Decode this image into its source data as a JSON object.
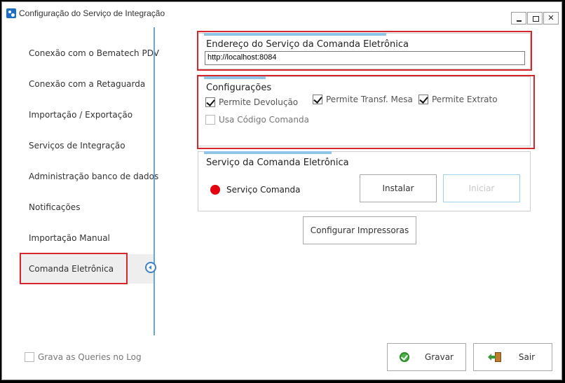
{
  "window": {
    "title": "Configuração do Serviço de Integração",
    "minimize_label": "",
    "maximize_label": "",
    "close_label": "✕"
  },
  "sidebar": {
    "items": [
      {
        "label": "Conexão com o Bematech PDV"
      },
      {
        "label": "Conexão com a Retaguarda"
      },
      {
        "label": "Importação / Exportação"
      },
      {
        "label": "Serviços de Integração"
      },
      {
        "label": "Administração banco de dados"
      },
      {
        "label": "Notificações"
      },
      {
        "label": "Importação Manual"
      },
      {
        "label": "Comanda Eletrônica",
        "active": true
      }
    ]
  },
  "address_group": {
    "title": "Endereço do Serviço da Comanda Eletrônica",
    "url_value": "http://localhost:8084"
  },
  "config_group": {
    "title": "Configurações",
    "options": [
      {
        "label": "Permite Devolução",
        "checked": true
      },
      {
        "label": "Permite Transf. Mesa",
        "checked": true
      },
      {
        "label": "Permite Extrato",
        "checked": true
      },
      {
        "label": "Usa Código Comanda",
        "checked": false
      }
    ]
  },
  "service_group": {
    "title": "Serviço da Comanda Eletrônica",
    "status_label": "Serviço Comanda",
    "status_color": "#e3000f",
    "install_label": "Instalar",
    "start_label": "Iniciar"
  },
  "configure_printers_label": "Configurar Impressoras",
  "footer": {
    "log_queries_label": "Grava as Queries no Log",
    "log_queries_checked": false,
    "save_label": "Gravar",
    "exit_label": "Sair"
  },
  "colors": {
    "highlight_red": "#d7262e",
    "accent_blue": "#8fc3e8",
    "divider_blue": "#6aa6d6"
  }
}
